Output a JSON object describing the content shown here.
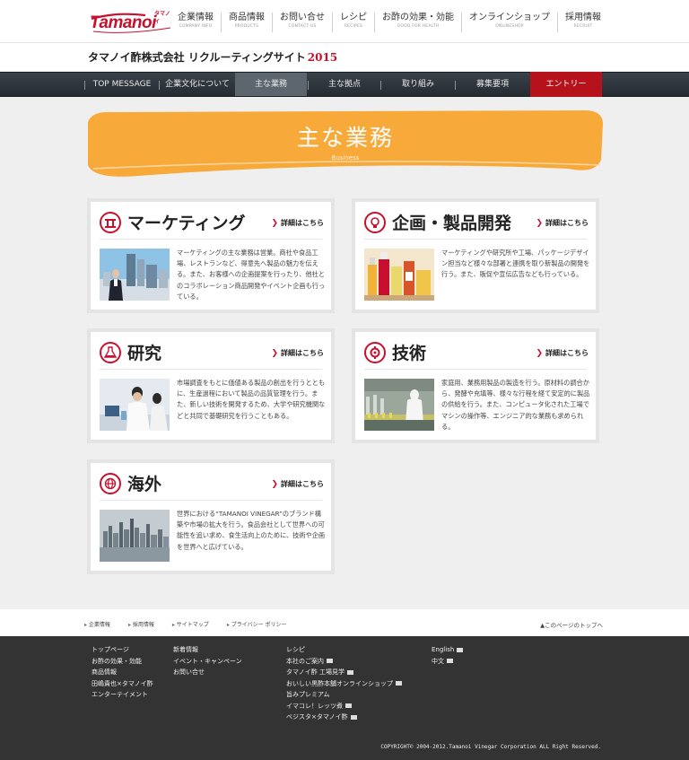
{
  "header": {
    "logo_text": "Tamanoi",
    "logo_katakana": "タマノイ",
    "nav": [
      {
        "jp": "企業情報",
        "en": "COMPANY INFO"
      },
      {
        "jp": "商品情報",
        "en": "PRODUCTS"
      },
      {
        "jp": "お問い合せ",
        "en": "CONTACT US"
      },
      {
        "jp": "レシピ",
        "en": "RECIPES"
      },
      {
        "jp": "お酢の効果・効能",
        "en": "GOOD FOR HEALTH"
      },
      {
        "jp": "オンラインショップ",
        "en": "ONLINESHOP"
      },
      {
        "jp": "採用情報",
        "en": "RECRUIT"
      }
    ]
  },
  "site_title": {
    "text": "タマノイ酢株式会社 リクルーティングサイト",
    "year": "2015"
  },
  "subnav": [
    "TOP MESSAGE",
    "企業文化について",
    "主な業務",
    "主な拠点",
    "取り組み",
    "募集要項",
    "エントリー"
  ],
  "banner": {
    "title": "主な業務",
    "subtitle": "Business"
  },
  "cards": [
    {
      "title": "マーケティング",
      "icon": "marketing-icon",
      "link": "詳細はこちら",
      "text": "マーケティングの主な業務は営業。商社や食品工場、レストランなど、得意先へ製品の魅力を伝える。また、お客様への企画提案を行ったり、他社とのコラボレーション商品開発やイベント企画も行っている。"
    },
    {
      "title": "企画・製品開発",
      "icon": "lightbulb-icon",
      "link": "詳細はこちら",
      "text": "マーケティングや研究所や工場、パッケージデザイン担当など様々な部署と連携を取り新製品の開発を行う。また、販促や宣伝広告なども行っている。"
    },
    {
      "title": "研究",
      "icon": "flask-icon",
      "link": "詳細はこちら",
      "text": "市場調査をもとに価値ある製品の創出を行うとともに、生産過程において製品の品質管理を行う。また、新しい技術を開発するため、大学や研究機関などと共同で基礎研究を行うこともある。"
    },
    {
      "title": "技術",
      "icon": "gear-icon",
      "link": "詳細はこちら",
      "text": "家庭用、業務用製品の製造を行う。原材料の調合から、発酵や充填等、様々な行程を経て安定的に製品の供給を行う。また、コンピュータ化された工場でマシンの操作等、エンジニア的な業務も求められる。"
    },
    {
      "title": "海外",
      "icon": "globe-icon",
      "link": "詳細はこちら",
      "text": "世界における“TAMANOI VINEGAR”のブランド構築や市場の拡大を行う。食品会社として世界への可能性を追い求め、食生活向上のために、技術や企画を世界へと広げている。"
    }
  ],
  "footer": {
    "links": [
      "企業情報",
      "採用情報",
      "サイトマップ",
      "プライバシー ポリシー"
    ],
    "pagetop": "▲このページのトップへ",
    "col1": [
      "トップページ",
      "お酢の効果・効能",
      "商品情報",
      "田嶋貴也×タマノイ酢",
      "エンターテイメント"
    ],
    "col2": [
      "新着情報",
      "イベント・キャンペーン",
      "お問い合せ"
    ],
    "col3": [
      "レシピ",
      "本社のご案内",
      "タマノイ酢 工場見学",
      "おいしい黒酢本舗オンラインショップ",
      "旨みプレミアム",
      "イマコレ！レッツ煮",
      "ベジスタ×タマノイ酢"
    ],
    "col3_ext": [
      false,
      true,
      true,
      true,
      false,
      true,
      true
    ],
    "col4": [
      "English",
      "中文"
    ],
    "copyright": "COPYRIGHT© 2004-2012.Tamanoi Vinegar Corporation ALL Right Reserved."
  }
}
